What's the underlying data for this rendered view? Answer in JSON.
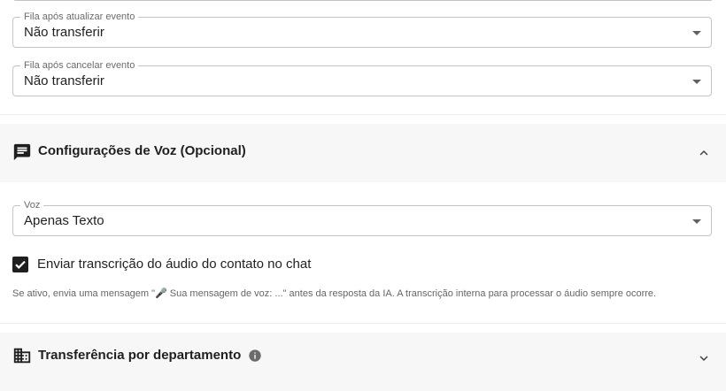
{
  "queue_after_update": {
    "label": "Fila após atualizar evento",
    "value": "Não transferir"
  },
  "queue_after_cancel": {
    "label": "Fila após cancelar evento",
    "value": "Não transferir"
  },
  "voice_section": {
    "title": "Configurações de Voz (Opcional)",
    "expanded": true,
    "icon": "chat-message-icon",
    "voice_field": {
      "label": "Voz",
      "value": "Apenas Texto"
    },
    "transcription_checkbox": {
      "label": "Enviar transcrição do áudio do contato no chat",
      "checked": true
    },
    "helper_text": "Se ativo, envia uma mensagem \"🎤 Sua mensagem de voz: ...\" antes da resposta da IA. A transcrição interna para processar o áudio sempre ocorre."
  },
  "department_section": {
    "title": "Transferência por departamento",
    "expanded": false,
    "icon": "building-icon"
  },
  "colors": {
    "accent": "#1f1f1f",
    "border": "#c4c4c4",
    "header_bg": "#f7f7f7"
  }
}
